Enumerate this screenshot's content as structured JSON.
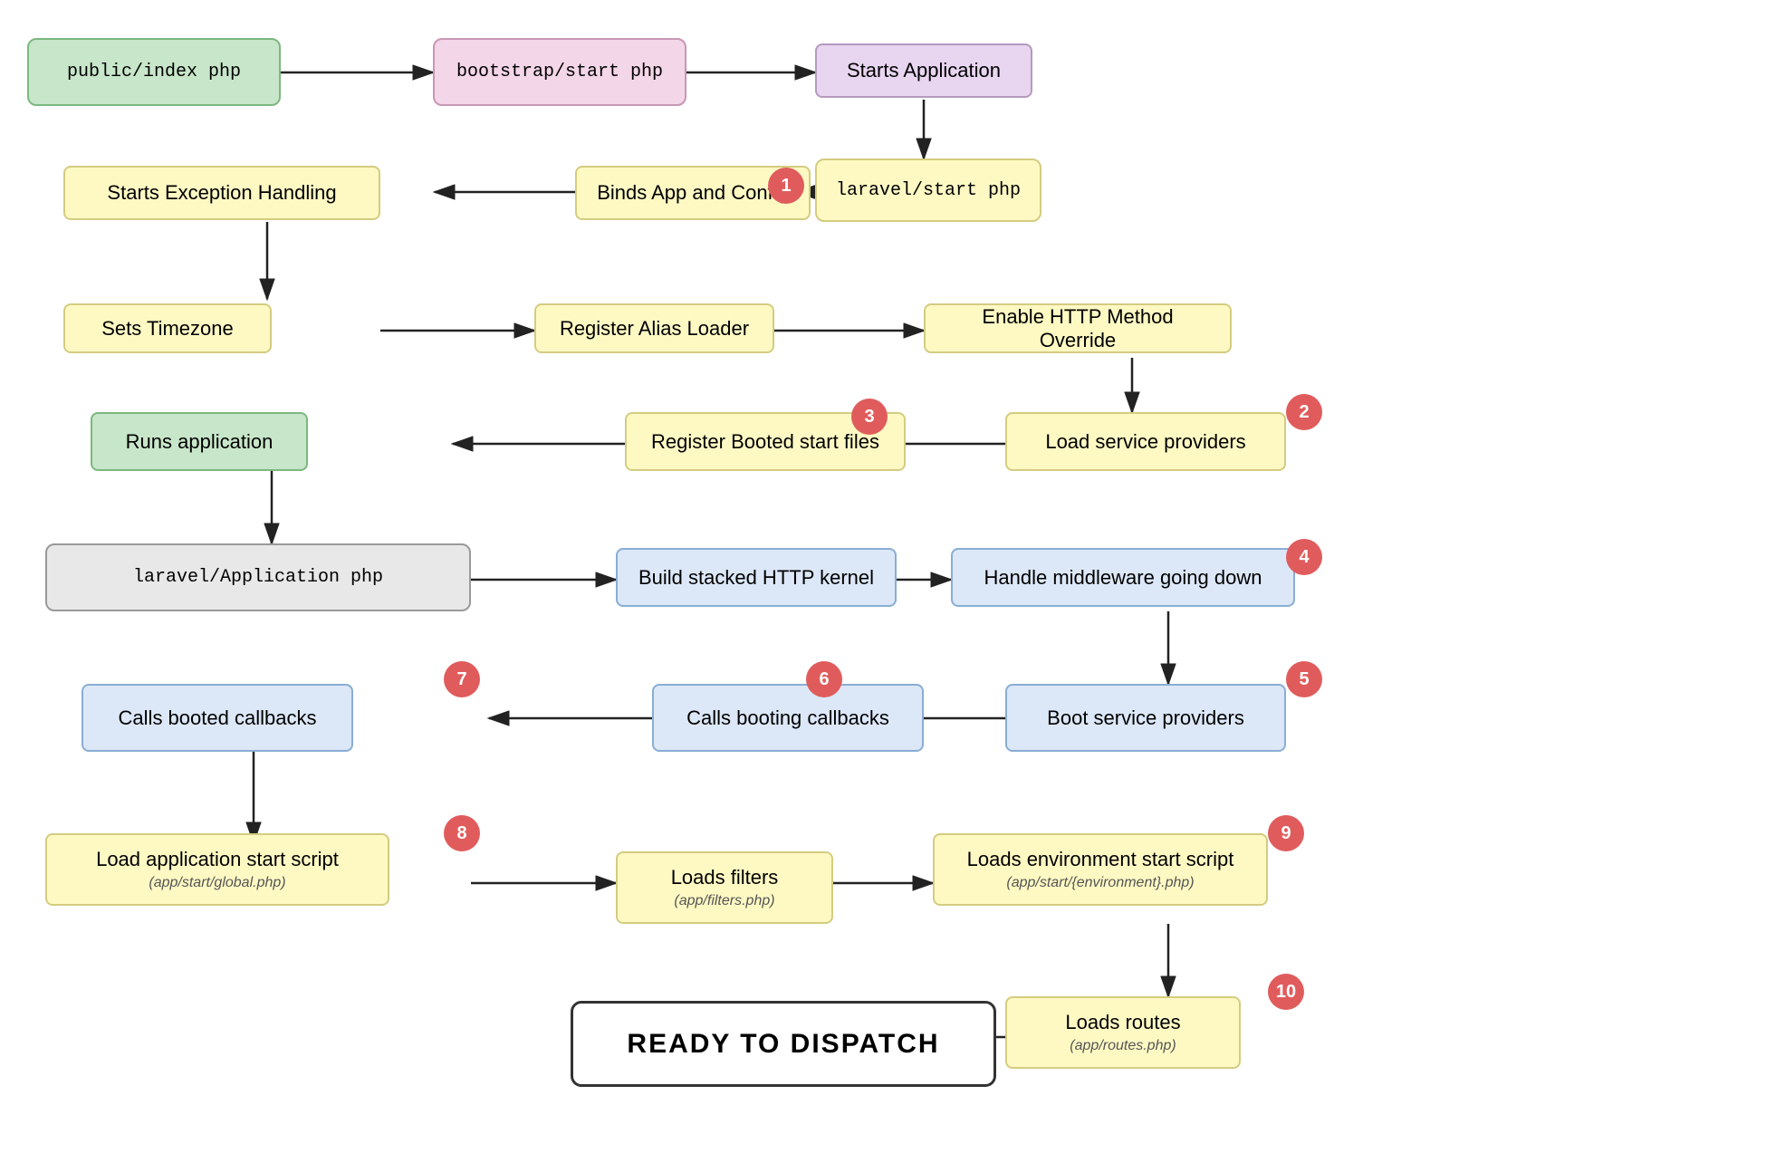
{
  "nodes": {
    "public_index": {
      "label": "public/index php",
      "type": "code",
      "color": "green-bg"
    },
    "bootstrap_start": {
      "label": "bootstrap/start php",
      "type": "code",
      "color": "pink-bg"
    },
    "starts_application": {
      "label": "Starts Application",
      "type": "plain",
      "color": "lavender-bg"
    },
    "laravel_start": {
      "label": "laravel/start php",
      "type": "code",
      "color": "light-yellow-bg"
    },
    "binds_app": {
      "label": "Binds App and Config",
      "type": "plain",
      "color": "light-yellow-bg"
    },
    "starts_exception": {
      "label": "Starts Exception Handling",
      "type": "plain",
      "color": "light-yellow-bg"
    },
    "sets_timezone": {
      "label": "Sets Timezone",
      "type": "plain",
      "color": "light-yellow-bg"
    },
    "register_alias": {
      "label": "Register Alias Loader",
      "type": "plain",
      "color": "light-yellow-bg"
    },
    "enable_http": {
      "label": "Enable HTTP Method Override",
      "type": "plain",
      "color": "light-yellow-bg"
    },
    "load_service": {
      "label": "Load service providers",
      "type": "plain",
      "color": "light-yellow-bg"
    },
    "register_booted": {
      "label": "Register Booted start files",
      "type": "plain",
      "color": "light-yellow-bg"
    },
    "runs_application": {
      "label": "Runs application",
      "type": "plain",
      "color": "green-bg"
    },
    "laravel_app": {
      "label": "laravel/Application php",
      "type": "code",
      "color": "gray-bg"
    },
    "build_stacked": {
      "label": "Build stacked HTTP kernel",
      "type": "plain",
      "color": "blue-bg"
    },
    "handle_middleware": {
      "label": "Handle middleware going down",
      "type": "plain",
      "color": "blue-bg"
    },
    "boot_service": {
      "label": "Boot service providers",
      "type": "plain",
      "color": "blue-bg"
    },
    "calls_booting": {
      "label": "Calls booting callbacks",
      "type": "plain",
      "color": "blue-bg"
    },
    "calls_booted": {
      "label": "Calls booted callbacks",
      "type": "plain",
      "color": "blue-bg"
    },
    "load_app_start": {
      "label": "Load application start script",
      "subtitle": "(app/start/global.php)",
      "type": "plain",
      "color": "light-yellow-bg"
    },
    "loads_filters": {
      "label": "Loads filters",
      "subtitle": "(app/filters.php)",
      "type": "plain",
      "color": "light-yellow-bg"
    },
    "loads_env": {
      "label": "Loads environment start script",
      "subtitle": "(app/start/{environment}.php)",
      "type": "plain",
      "color": "light-yellow-bg"
    },
    "loads_routes": {
      "label": "Loads routes",
      "subtitle": "(app/routes.php)",
      "type": "plain",
      "color": "light-yellow-bg"
    },
    "ready": {
      "label": "READY TO DISPATCH",
      "type": "plain",
      "color": "white-bg"
    }
  },
  "badges": [
    {
      "id": "b1",
      "num": "1"
    },
    {
      "id": "b2",
      "num": "2"
    },
    {
      "id": "b3",
      "num": "3"
    },
    {
      "id": "b4",
      "num": "4"
    },
    {
      "id": "b5",
      "num": "5"
    },
    {
      "id": "b6",
      "num": "6"
    },
    {
      "id": "b7",
      "num": "7"
    },
    {
      "id": "b8",
      "num": "8"
    },
    {
      "id": "b9",
      "num": "9"
    },
    {
      "id": "b10",
      "num": "10"
    }
  ]
}
